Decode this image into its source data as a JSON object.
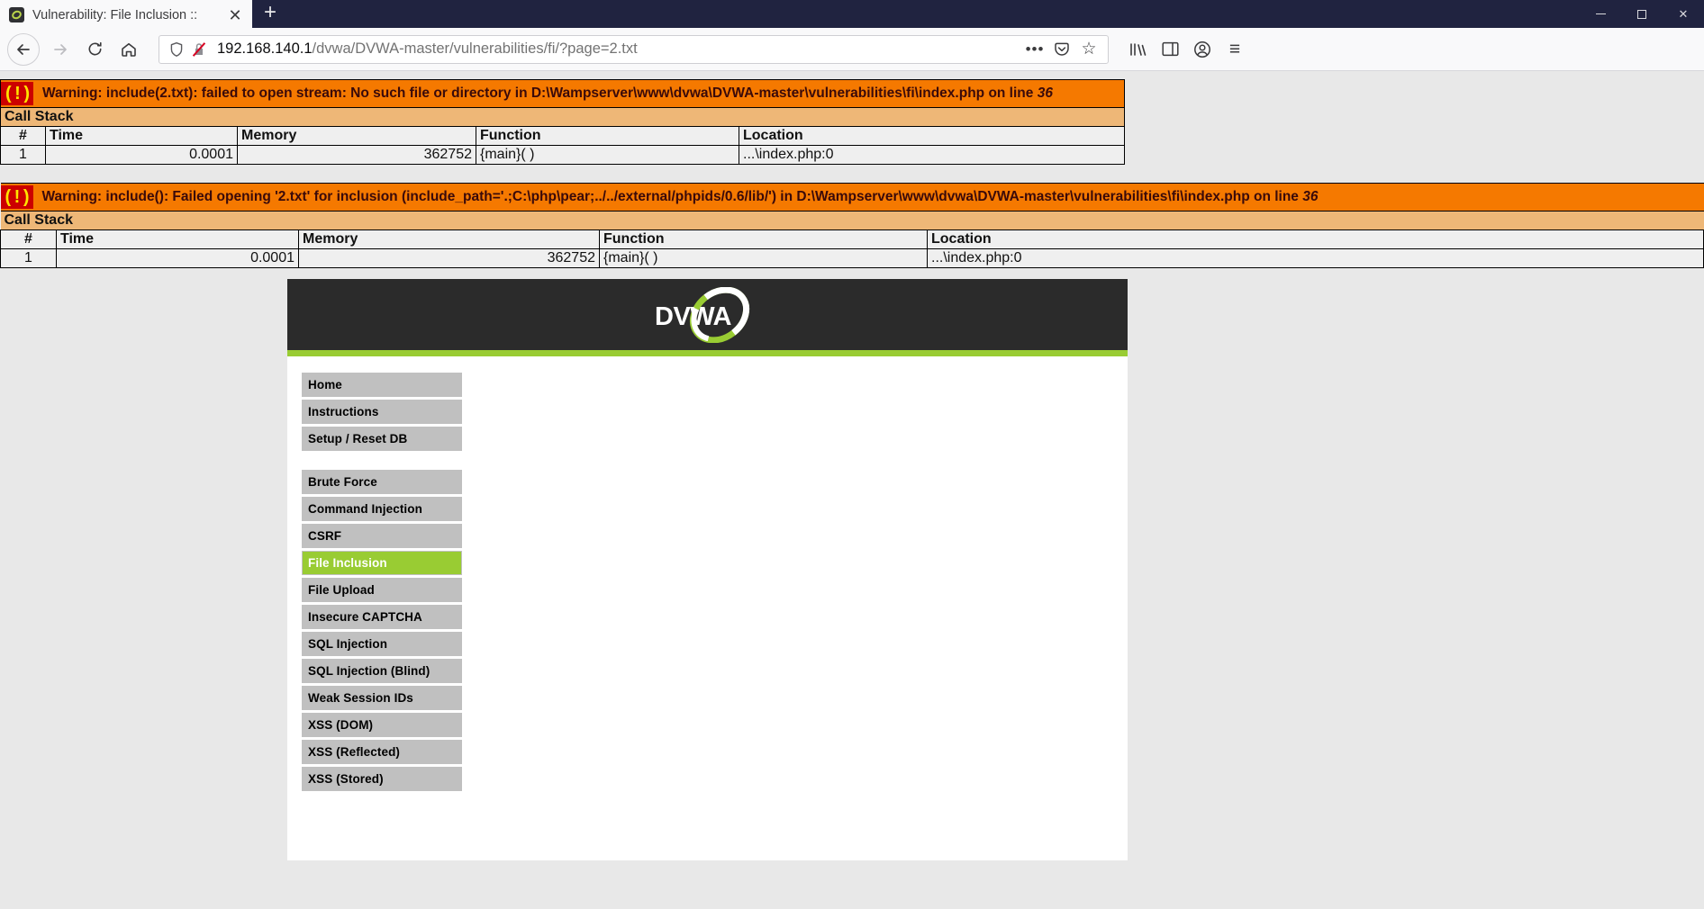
{
  "browser": {
    "tab": {
      "title": "Vulnerability: File Inclusion ::",
      "favicon_name": "dvwa-favicon",
      "close_glyph": "✕"
    },
    "newtab_glyph": "+",
    "window_controls": {
      "minimize": "minimize",
      "maximize": "maximize",
      "close": "✕"
    },
    "nav": {
      "back_glyph": "←",
      "forward_glyph": "→",
      "reload_glyph": "⟳",
      "home_glyph": "⌂"
    },
    "url": {
      "host": "192.168.140.1",
      "path": "/dvwa/DVWA-master/vulnerabilities/fi/?page=2.txt",
      "full": "192.168.140.1/dvwa/DVWA-master/vulnerabilities/fi/?page=2.txt",
      "shield_icon": "tracking-protection-shield-icon",
      "security_icon": "broken-lock-icon"
    },
    "url_actions": {
      "more": "•••",
      "pocket": "pocket-icon",
      "bookmark": "☆"
    },
    "toolbar_end": {
      "library": "library-icon",
      "sidebars": "sidebars-icon",
      "account": "account-icon",
      "menu": "≡"
    }
  },
  "warnings": [
    {
      "bang": "( ! )",
      "prefix": "Warning: include(2.txt): failed to open stream: No such file or directory in D:\\Wampserver\\www\\dvwa\\DVWA-master\\vulnerabilities\\fi\\index.php on line ",
      "line_number": "36",
      "call_stack_label": "Call Stack",
      "columns": [
        "#",
        "Time",
        "Memory",
        "Function",
        "Location"
      ],
      "rows": [
        {
          "num": "1",
          "time": "0.0001",
          "memory": "362752",
          "function": "{main}(  )",
          "location": "...\\index.php:0"
        }
      ]
    },
    {
      "bang": "( ! )",
      "prefix": "Warning: include(): Failed opening '2.txt' for inclusion (include_path='.;C:\\php\\pear;../../external/phpids/0.6/lib/') in D:\\Wampserver\\www\\dvwa\\DVWA-master\\vulnerabilities\\fi\\index.php on line ",
      "line_number": "36",
      "call_stack_label": "Call Stack",
      "columns": [
        "#",
        "Time",
        "Memory",
        "Function",
        "Location"
      ],
      "rows": [
        {
          "num": "1",
          "time": "0.0001",
          "memory": "362752",
          "function": "{main}(  )",
          "location": "...\\index.php:0"
        }
      ]
    }
  ],
  "dvwa": {
    "logo_text": "DVWA",
    "nav_groups": [
      [
        "Home",
        "Instructions",
        "Setup / Reset DB"
      ],
      [
        "Brute Force",
        "Command Injection",
        "CSRF",
        "File Inclusion",
        "File Upload",
        "Insecure CAPTCHA",
        "SQL Injection",
        "SQL Injection (Blind)",
        "Weak Session IDs",
        "XSS (DOM)",
        "XSS (Reflected)",
        "XSS (Stored)"
      ]
    ],
    "active_item": "File Inclusion"
  },
  "colors": {
    "warning_bg": "#f57900",
    "warning_text": "#3a0a0a",
    "callstack_bg": "#eeb777",
    "bang_bg": "#cc0000",
    "bang_fg": "#ffe400",
    "dvwa_header": "#2b2b2b",
    "dvwa_accent": "#99cc33",
    "nav_item_bg": "#c0c0c0",
    "browser_tabstrip": "#202340"
  }
}
